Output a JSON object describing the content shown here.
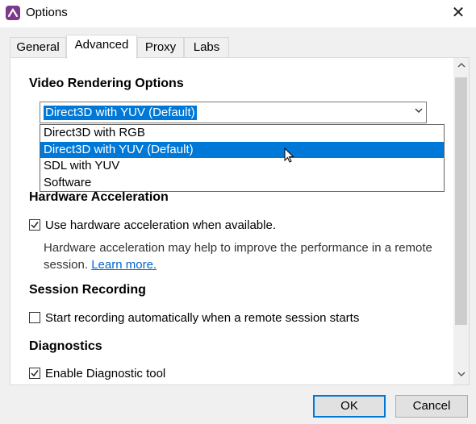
{
  "window": {
    "title": "Options",
    "app_icon": "remote-app-logo-icon",
    "close_glyph": "✕"
  },
  "tabs": [
    {
      "label": "General"
    },
    {
      "label": "Advanced"
    },
    {
      "label": "Proxy"
    },
    {
      "label": "Labs"
    }
  ],
  "video": {
    "heading": "Video Rendering Options",
    "selected": "Direct3D with YUV (Default)",
    "options": [
      "Direct3D with RGB",
      "Direct3D with YUV (Default)",
      "SDL with YUV",
      "Software"
    ]
  },
  "hardware": {
    "heading": "Hardware Acceleration",
    "checkbox_label": "Use hardware acceleration when available.",
    "checked": true,
    "description": "Hardware acceleration may help to improve the performance in a remote session.",
    "link": "Learn more."
  },
  "recording": {
    "heading": "Session Recording",
    "checkbox_label": "Start recording automatically when a remote session starts",
    "checked": false
  },
  "diagnostics": {
    "heading": "Diagnostics",
    "checkbox_label": "Enable Diagnostic tool",
    "checked": true
  },
  "buttons": {
    "ok": "OK",
    "cancel": "Cancel"
  },
  "colors": {
    "accent": "#0078d7",
    "link": "#0066cc",
    "app_icon": "#7b3a8c"
  }
}
